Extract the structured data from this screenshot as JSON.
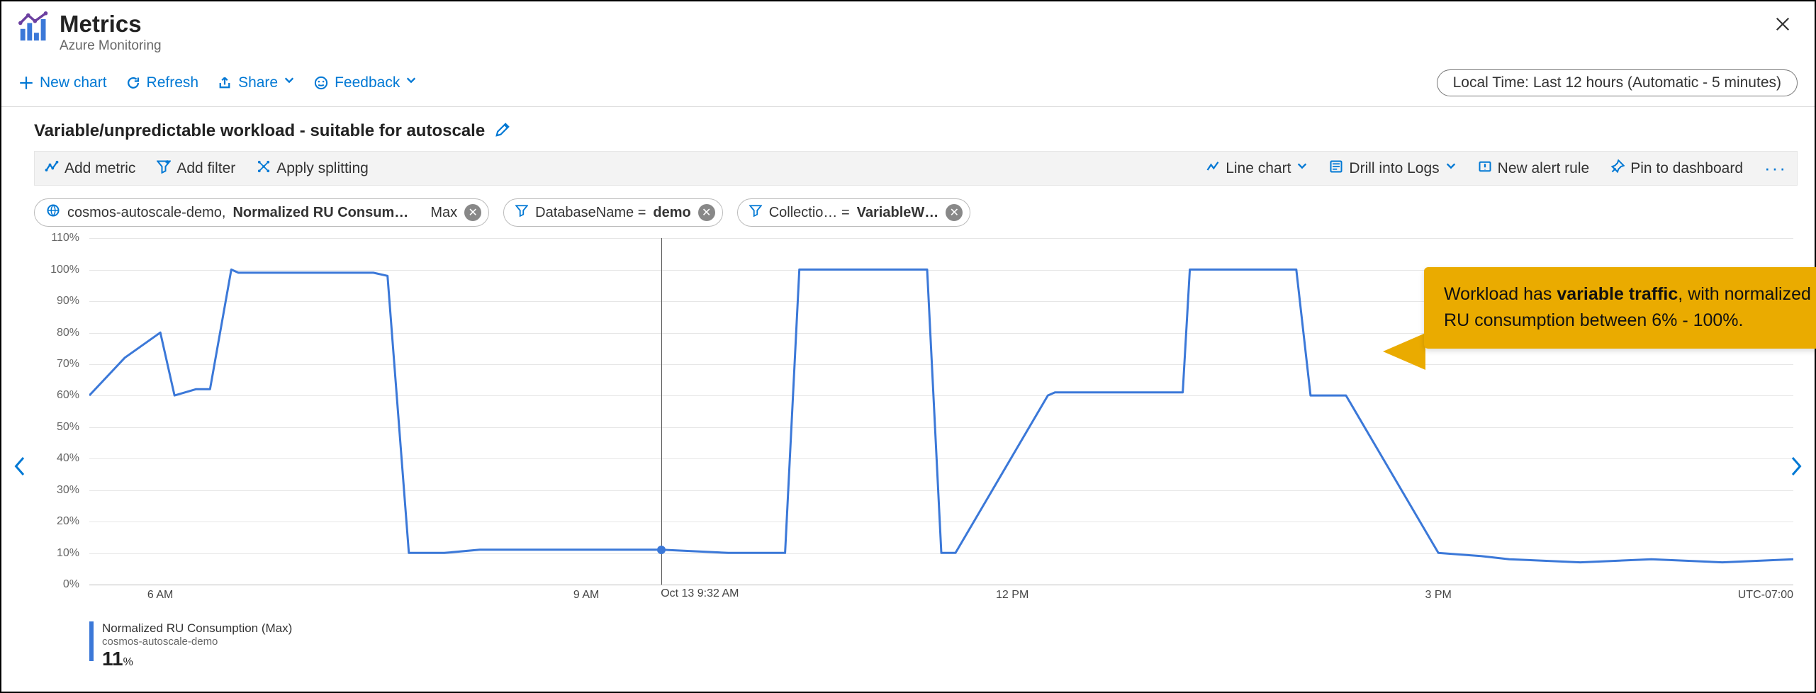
{
  "header": {
    "title": "Metrics",
    "subtitle": "Azure Monitoring"
  },
  "toolbar": {
    "new_chart": "New chart",
    "refresh": "Refresh",
    "share": "Share",
    "feedback": "Feedback",
    "time_range": "Local Time: Last 12 hours (Automatic - 5 minutes)"
  },
  "chart": {
    "title": "Variable/unpredictable workload - suitable for autoscale"
  },
  "config": {
    "add_metric": "Add metric",
    "add_filter": "Add filter",
    "apply_splitting": "Apply splitting",
    "chart_type": "Line chart",
    "drill_logs": "Drill into Logs",
    "new_alert": "New alert rule",
    "pin": "Pin to dashboard"
  },
  "pills": {
    "scope_prefix": "cosmos-autoscale-demo, ",
    "scope_metric": "Normalized RU Consum…",
    "scope_agg": "Max",
    "filter1_key": "DatabaseName = ",
    "filter1_val": "demo",
    "filter2_key": "Collectio… = ",
    "filter2_val": "VariableW…"
  },
  "callout": {
    "line1_pre": "Workload has ",
    "line1_bold": "variable traffic",
    "line1_post": ", with normalized",
    "line2": "RU consumption between 6% - 100%."
  },
  "legend": {
    "title": "Normalized RU Consumption (Max)",
    "subtitle": "cosmos-autoscale-demo",
    "value": "11",
    "unit": "%"
  },
  "crosshair": {
    "time_label": "Oct 13 9:32 AM"
  },
  "axes": {
    "y_ticks": [
      "110%",
      "100%",
      "90%",
      "80%",
      "70%",
      "60%",
      "50%",
      "40%",
      "30%",
      "20%",
      "10%",
      "0%"
    ],
    "x_ticks": [
      "6 AM",
      "9 AM",
      "12 PM",
      "3 PM"
    ],
    "tz": "UTC-07:00"
  },
  "chart_data": {
    "type": "line",
    "title": "Variable/unpredictable workload - suitable for autoscale",
    "xlabel": "",
    "ylabel": "Normalized RU Consumption (Max) %",
    "ylim": [
      0,
      110
    ],
    "x_range_hours": [
      5.5,
      17.5
    ],
    "series": [
      {
        "name": "Normalized RU Consumption (Max)",
        "color": "#3b78d8",
        "x": [
          5.5,
          5.75,
          6.0,
          6.1,
          6.25,
          6.35,
          6.5,
          6.55,
          7.5,
          7.6,
          7.75,
          8.0,
          8.25,
          9.0,
          9.53,
          10.0,
          10.25,
          10.4,
          10.5,
          11.4,
          11.5,
          11.6,
          12.25,
          12.3,
          13.2,
          13.25,
          14.0,
          14.1,
          14.25,
          14.35,
          15.0,
          15.3,
          15.5,
          16.0,
          16.5,
          17.0,
          17.5
        ],
        "y": [
          60,
          72,
          80,
          60,
          62,
          62,
          100,
          99,
          99,
          98,
          10,
          10,
          11,
          11,
          11,
          10,
          10,
          10,
          100,
          100,
          10,
          10,
          60,
          61,
          61,
          100,
          100,
          60,
          60,
          60,
          10,
          9,
          8,
          7,
          8,
          7,
          8
        ]
      }
    ],
    "crosshair": {
      "x": 9.53,
      "y": 11,
      "label": "Oct 13 9:32 AM"
    },
    "annotations": [
      {
        "text": "Workload has variable traffic, with normalized RU consumption between 6% - 100%.",
        "anchor_x": 14.6
      }
    ]
  }
}
